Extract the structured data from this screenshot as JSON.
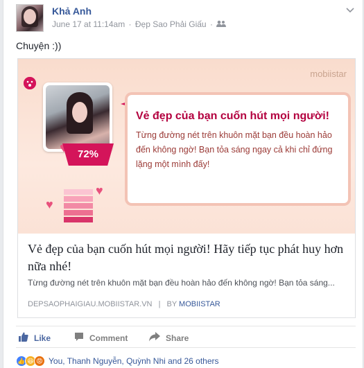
{
  "post": {
    "author": "Khả Anh",
    "time": "June 17 at 11:14am",
    "separator": "·",
    "location": "Đẹp Sao Phải Giấu",
    "privacy_icon": "friends-icon",
    "status_text": "Chuyện :))"
  },
  "link_card": {
    "banner": {
      "brand": "mobiistar",
      "percent": "72%",
      "headline": "Vẻ đẹp của bạn cuốn hút mọi người!",
      "body": "Từng đường nét trên khuôn mặt bạn đều hoàn hảo đến không ngờ! Bạn tỏa sáng ngay cả khi chỉ đứng lặng một mình đấy!"
    },
    "title": "Vẻ đẹp của bạn cuốn hút mọi người! Hãy tiếp tục phát huy hơn nữa nhé!",
    "description": "Từng đường nét trên khuôn mặt bạn đều hoàn hảo đến không ngờ! Bạn tỏa sáng...",
    "domain": "DEPSAOPHAIGIAU.MOBIISTAR.VN",
    "divider": "|",
    "by_label": "BY",
    "by_source": "MOBIISTAR"
  },
  "actions": {
    "like": "Like",
    "comment": "Comment",
    "share": "Share"
  },
  "reactions": {
    "text": "You, Thanh Nguyễn, Quỳnh Nhi and 26 others",
    "types": [
      "like-icon",
      "haha-icon",
      "angry-icon"
    ]
  },
  "colors": {
    "link_blue": "#365899",
    "accent_pink": "#d4145a",
    "meta_gray": "#90949c"
  }
}
